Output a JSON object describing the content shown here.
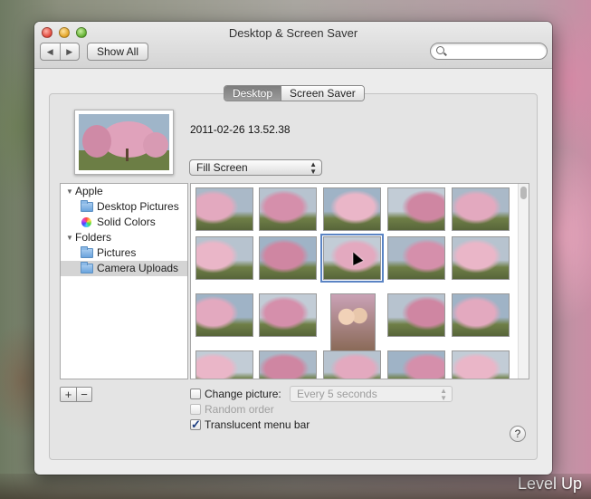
{
  "window": {
    "title": "Desktop & Screen Saver"
  },
  "toolbar": {
    "back_icon": "back-arrow-icon",
    "forward_icon": "forward-arrow-icon",
    "show_all_label": "Show All",
    "search_placeholder": ""
  },
  "tabs": [
    {
      "label": "Desktop",
      "active": true
    },
    {
      "label": "Screen Saver",
      "active": false
    }
  ],
  "current": {
    "filename": "2011-02-26 13.52.38",
    "fit_option": "Fill Screen"
  },
  "sidebar": {
    "groups": [
      {
        "label": "Apple",
        "items": [
          {
            "label": "Desktop Pictures",
            "icon": "folder-icon",
            "selected": false
          },
          {
            "label": "Solid Colors",
            "icon": "color-wheel-icon",
            "selected": false
          }
        ]
      },
      {
        "label": "Folders",
        "items": [
          {
            "label": "Pictures",
            "icon": "folder-icon",
            "selected": false
          },
          {
            "label": "Camera Uploads",
            "icon": "folder-icon",
            "selected": true
          }
        ]
      }
    ]
  },
  "buttons": {
    "add": "+",
    "remove": "−",
    "help": "?"
  },
  "options": {
    "change_picture_label": "Change picture:",
    "change_picture_checked": false,
    "interval_value": "Every 5 seconds",
    "random_order_label": "Random order",
    "random_order_checked": false,
    "translucent_label": "Translucent menu bar",
    "translucent_checked": true
  },
  "watermark": "Level Up",
  "colors": {
    "selection": "#5b84c4",
    "active_tab": "#8a8a8a"
  }
}
